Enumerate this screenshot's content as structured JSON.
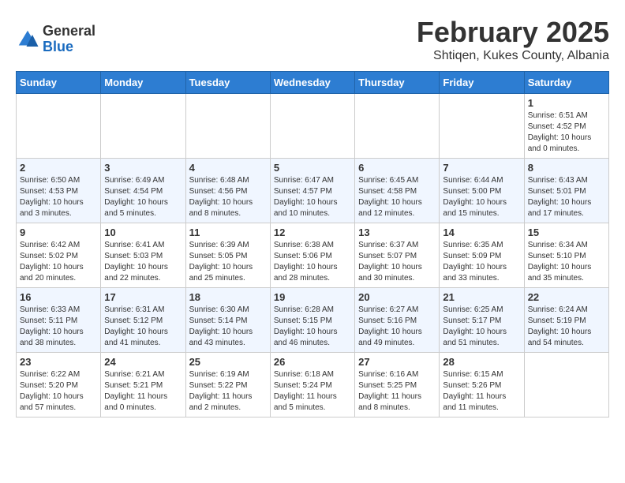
{
  "header": {
    "logo_general": "General",
    "logo_blue": "Blue",
    "month_title": "February 2025",
    "location": "Shtiqen, Kukes County, Albania"
  },
  "days_of_week": [
    "Sunday",
    "Monday",
    "Tuesday",
    "Wednesday",
    "Thursday",
    "Friday",
    "Saturday"
  ],
  "weeks": [
    [
      {
        "day": "",
        "info": ""
      },
      {
        "day": "",
        "info": ""
      },
      {
        "day": "",
        "info": ""
      },
      {
        "day": "",
        "info": ""
      },
      {
        "day": "",
        "info": ""
      },
      {
        "day": "",
        "info": ""
      },
      {
        "day": "1",
        "info": "Sunrise: 6:51 AM\nSunset: 4:52 PM\nDaylight: 10 hours\nand 0 minutes."
      }
    ],
    [
      {
        "day": "2",
        "info": "Sunrise: 6:50 AM\nSunset: 4:53 PM\nDaylight: 10 hours\nand 3 minutes."
      },
      {
        "day": "3",
        "info": "Sunrise: 6:49 AM\nSunset: 4:54 PM\nDaylight: 10 hours\nand 5 minutes."
      },
      {
        "day": "4",
        "info": "Sunrise: 6:48 AM\nSunset: 4:56 PM\nDaylight: 10 hours\nand 8 minutes."
      },
      {
        "day": "5",
        "info": "Sunrise: 6:47 AM\nSunset: 4:57 PM\nDaylight: 10 hours\nand 10 minutes."
      },
      {
        "day": "6",
        "info": "Sunrise: 6:45 AM\nSunset: 4:58 PM\nDaylight: 10 hours\nand 12 minutes."
      },
      {
        "day": "7",
        "info": "Sunrise: 6:44 AM\nSunset: 5:00 PM\nDaylight: 10 hours\nand 15 minutes."
      },
      {
        "day": "8",
        "info": "Sunrise: 6:43 AM\nSunset: 5:01 PM\nDaylight: 10 hours\nand 17 minutes."
      }
    ],
    [
      {
        "day": "9",
        "info": "Sunrise: 6:42 AM\nSunset: 5:02 PM\nDaylight: 10 hours\nand 20 minutes."
      },
      {
        "day": "10",
        "info": "Sunrise: 6:41 AM\nSunset: 5:03 PM\nDaylight: 10 hours\nand 22 minutes."
      },
      {
        "day": "11",
        "info": "Sunrise: 6:39 AM\nSunset: 5:05 PM\nDaylight: 10 hours\nand 25 minutes."
      },
      {
        "day": "12",
        "info": "Sunrise: 6:38 AM\nSunset: 5:06 PM\nDaylight: 10 hours\nand 28 minutes."
      },
      {
        "day": "13",
        "info": "Sunrise: 6:37 AM\nSunset: 5:07 PM\nDaylight: 10 hours\nand 30 minutes."
      },
      {
        "day": "14",
        "info": "Sunrise: 6:35 AM\nSunset: 5:09 PM\nDaylight: 10 hours\nand 33 minutes."
      },
      {
        "day": "15",
        "info": "Sunrise: 6:34 AM\nSunset: 5:10 PM\nDaylight: 10 hours\nand 35 minutes."
      }
    ],
    [
      {
        "day": "16",
        "info": "Sunrise: 6:33 AM\nSunset: 5:11 PM\nDaylight: 10 hours\nand 38 minutes."
      },
      {
        "day": "17",
        "info": "Sunrise: 6:31 AM\nSunset: 5:12 PM\nDaylight: 10 hours\nand 41 minutes."
      },
      {
        "day": "18",
        "info": "Sunrise: 6:30 AM\nSunset: 5:14 PM\nDaylight: 10 hours\nand 43 minutes."
      },
      {
        "day": "19",
        "info": "Sunrise: 6:28 AM\nSunset: 5:15 PM\nDaylight: 10 hours\nand 46 minutes."
      },
      {
        "day": "20",
        "info": "Sunrise: 6:27 AM\nSunset: 5:16 PM\nDaylight: 10 hours\nand 49 minutes."
      },
      {
        "day": "21",
        "info": "Sunrise: 6:25 AM\nSunset: 5:17 PM\nDaylight: 10 hours\nand 51 minutes."
      },
      {
        "day": "22",
        "info": "Sunrise: 6:24 AM\nSunset: 5:19 PM\nDaylight: 10 hours\nand 54 minutes."
      }
    ],
    [
      {
        "day": "23",
        "info": "Sunrise: 6:22 AM\nSunset: 5:20 PM\nDaylight: 10 hours\nand 57 minutes."
      },
      {
        "day": "24",
        "info": "Sunrise: 6:21 AM\nSunset: 5:21 PM\nDaylight: 11 hours\nand 0 minutes."
      },
      {
        "day": "25",
        "info": "Sunrise: 6:19 AM\nSunset: 5:22 PM\nDaylight: 11 hours\nand 2 minutes."
      },
      {
        "day": "26",
        "info": "Sunrise: 6:18 AM\nSunset: 5:24 PM\nDaylight: 11 hours\nand 5 minutes."
      },
      {
        "day": "27",
        "info": "Sunrise: 6:16 AM\nSunset: 5:25 PM\nDaylight: 11 hours\nand 8 minutes."
      },
      {
        "day": "28",
        "info": "Sunrise: 6:15 AM\nSunset: 5:26 PM\nDaylight: 11 hours\nand 11 minutes."
      },
      {
        "day": "",
        "info": ""
      }
    ]
  ]
}
